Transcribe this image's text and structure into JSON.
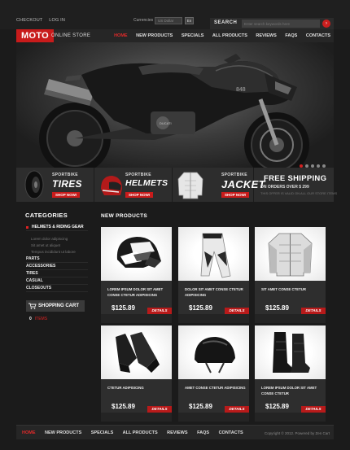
{
  "topbar": {
    "checkout": "CHECKOUT",
    "login": "LOG IN",
    "currencies_label": "Currencies",
    "currency_value": "US Dollar",
    "lang_btn": "En",
    "search_label": "SEARCH",
    "search_placeholder": "Enter search keywords here"
  },
  "header": {
    "logo": "MOTO",
    "store": "ONLINE STORE",
    "nav": [
      "HOME",
      "NEW PRODUCTS",
      "SPECIALS",
      "ALL PRODUCTS",
      "REVIEWS",
      "FAQS",
      "CONTACTS"
    ]
  },
  "hero": {
    "plate": "848"
  },
  "promo": [
    {
      "sub": "SPORTBIKE",
      "main": "TIRES",
      "shop": "SHOP NOW!"
    },
    {
      "sub": "SPORTBIKE",
      "main": "HELMETS",
      "shop": "SHOP NOW!"
    },
    {
      "sub": "SPORTBIKE",
      "main": "JACKET",
      "shop": "SHOP NOW!"
    }
  ],
  "shipping": {
    "title": "FREE SHIPPING",
    "sub": "ON ORDERS OVER $ 299",
    "note": "THIS OFFER IS VALID ON ALL OUR STORE ITEMS"
  },
  "categories": {
    "title": "CATEGORIES",
    "first": "HELMETS & RIDING GEAR",
    "subs": [
      "Lorem dolor adipiscing",
      "Sit amet ut aliquet",
      "Tempus incididunt ut labore"
    ],
    "mains": [
      "PARTS",
      "ACCESSORIES",
      "TIRES",
      "CASUAL",
      "CLOSEOUTS"
    ]
  },
  "cart": {
    "title": "SHOPPING CART",
    "count": "0",
    "items": "ITEMS"
  },
  "new_products": {
    "title": "NEW PRODUCTS",
    "details": "DETAILS",
    "items": [
      {
        "desc": "LOREM IPSUM DOLOR SIT AMET CONSE CTETUR ADIPISICING",
        "price": "$125.89",
        "icon": "motocross-helmet-icon"
      },
      {
        "desc": "DOLOR SIT AMET CONSE CTETUR ADIPISICING",
        "price": "$125.89",
        "icon": "riding-pants-icon"
      },
      {
        "desc": "SIT AMET CONSE CTETUR",
        "price": "$125.89",
        "icon": "riding-jacket-icon"
      },
      {
        "desc": "CTETUR ADIPISICING",
        "price": "$125.89",
        "icon": "riding-gloves-icon"
      },
      {
        "desc": "AMET CONSE CTETUR ADIPISICING",
        "price": "$125.89",
        "icon": "half-helmet-icon"
      },
      {
        "desc": "LOREM IPSUM DOLOR SIT AMET CONSE CTETUR",
        "price": "$125.89",
        "icon": "riding-boots-icon"
      }
    ]
  },
  "footer": {
    "nav": [
      "HOME",
      "NEW PRODUCTS",
      "SPECIALS",
      "ALL PRODUCTS",
      "REVIEWS",
      "FAQS",
      "CONTACTS"
    ],
    "copyright": "Copyright © 2012. Powered by Zen Cart"
  },
  "colors": {
    "accent": "#c81b1b",
    "background": "#1b1b1b",
    "panel": "#2d2d2d"
  }
}
